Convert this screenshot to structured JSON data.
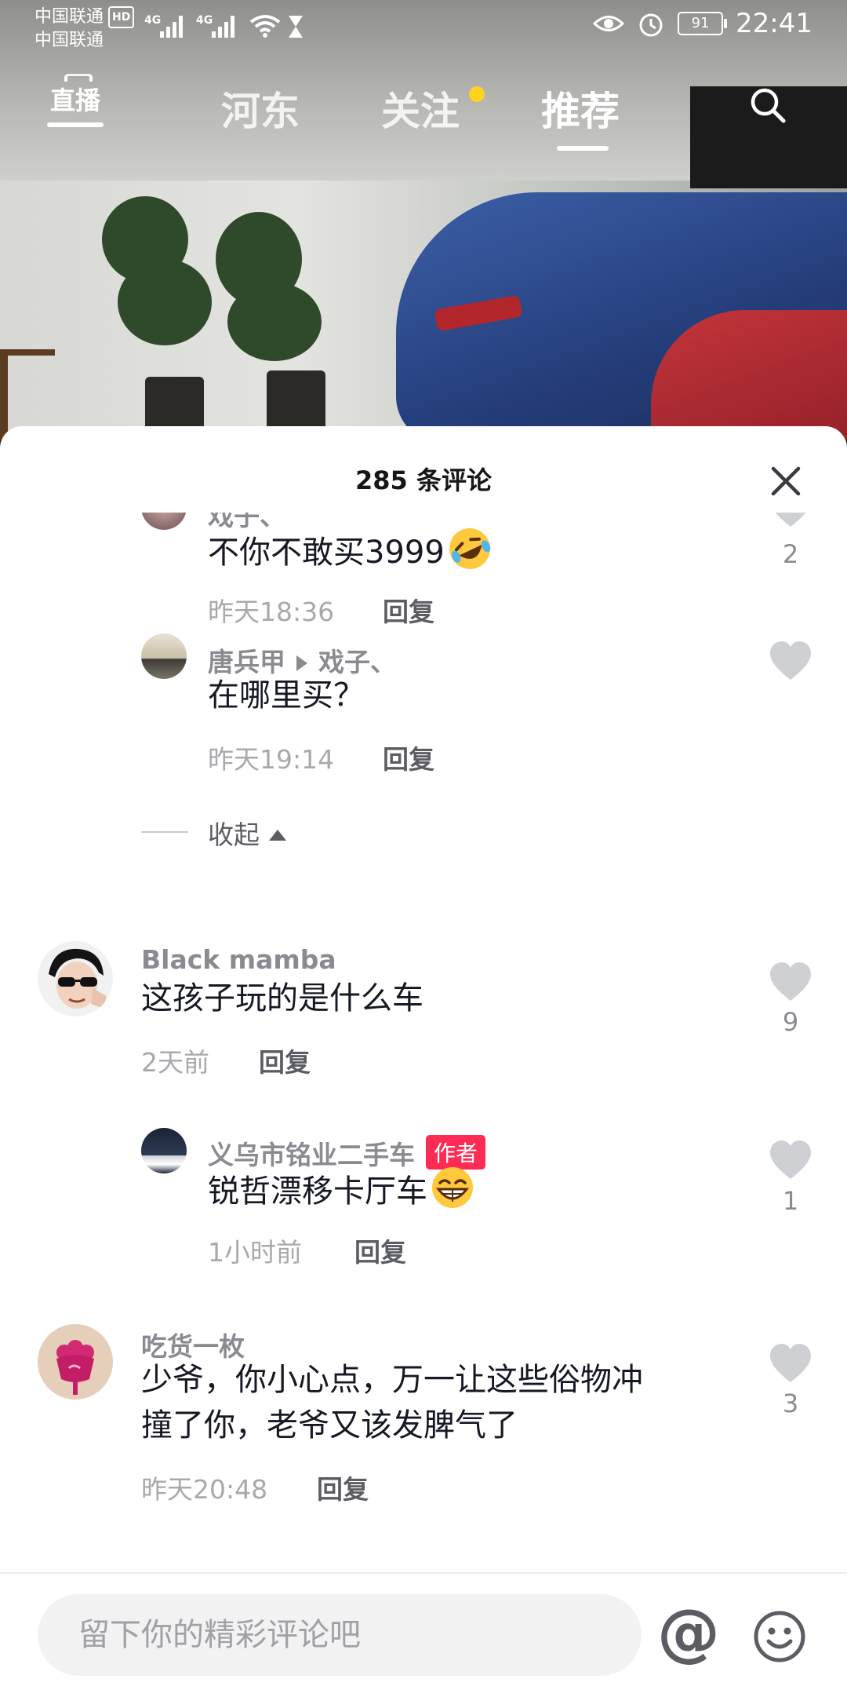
{
  "status_bar": {
    "carrier_1": "中国联通",
    "carrier_2": "中国联通",
    "hd_badge": "HD",
    "network_1": "4G",
    "network_2": "4G",
    "battery_level": "91",
    "time": "22:41"
  },
  "top_nav": {
    "live_label": "直播",
    "tabs": [
      {
        "label": "河东"
      },
      {
        "label": "关注"
      },
      {
        "label": "推荐"
      }
    ],
    "active_tab": "推荐",
    "notification_dot_color": "#ffd21f"
  },
  "comments_panel": {
    "title": "285 条评论",
    "reply_label": "回复",
    "collapse_label": "收起",
    "comments": [
      {
        "kind": "reply",
        "username": "戏子、",
        "text": "不你不敢买3999",
        "emoji": "rolling-laughing-emoji",
        "time": "昨天18:36",
        "likes": "2"
      },
      {
        "kind": "reply",
        "username": "唐兵甲",
        "reply_to": "戏子、",
        "text": "在哪里买？",
        "time": "昨天19:14",
        "likes": ""
      },
      {
        "kind": "top",
        "username": "Black mamba",
        "text": "这孩子玩的是什么车",
        "time": "2天前",
        "likes": "9"
      },
      {
        "kind": "reply",
        "username": "义乌市铭业二手车",
        "badge": "作者",
        "text": "锐哲漂移卡厅车",
        "emoji": "grinning-emoji",
        "time": "1小时前",
        "likes": "1"
      },
      {
        "kind": "top",
        "username": "吃货一枚",
        "text_lines": [
          "少爷，你小心点，万一让这些俗物冲",
          "撞了你，老爷又该发脾气了"
        ],
        "time": "昨天20:48",
        "likes": "3"
      }
    ]
  },
  "input_bar": {
    "placeholder": "留下你的精彩评论吧",
    "at_symbol": "@"
  },
  "colors": {
    "accent_red": "#fe2c55",
    "text_primary": "#161823",
    "text_secondary": "#8a8b90",
    "heart_gray": "#cfd0d3"
  }
}
